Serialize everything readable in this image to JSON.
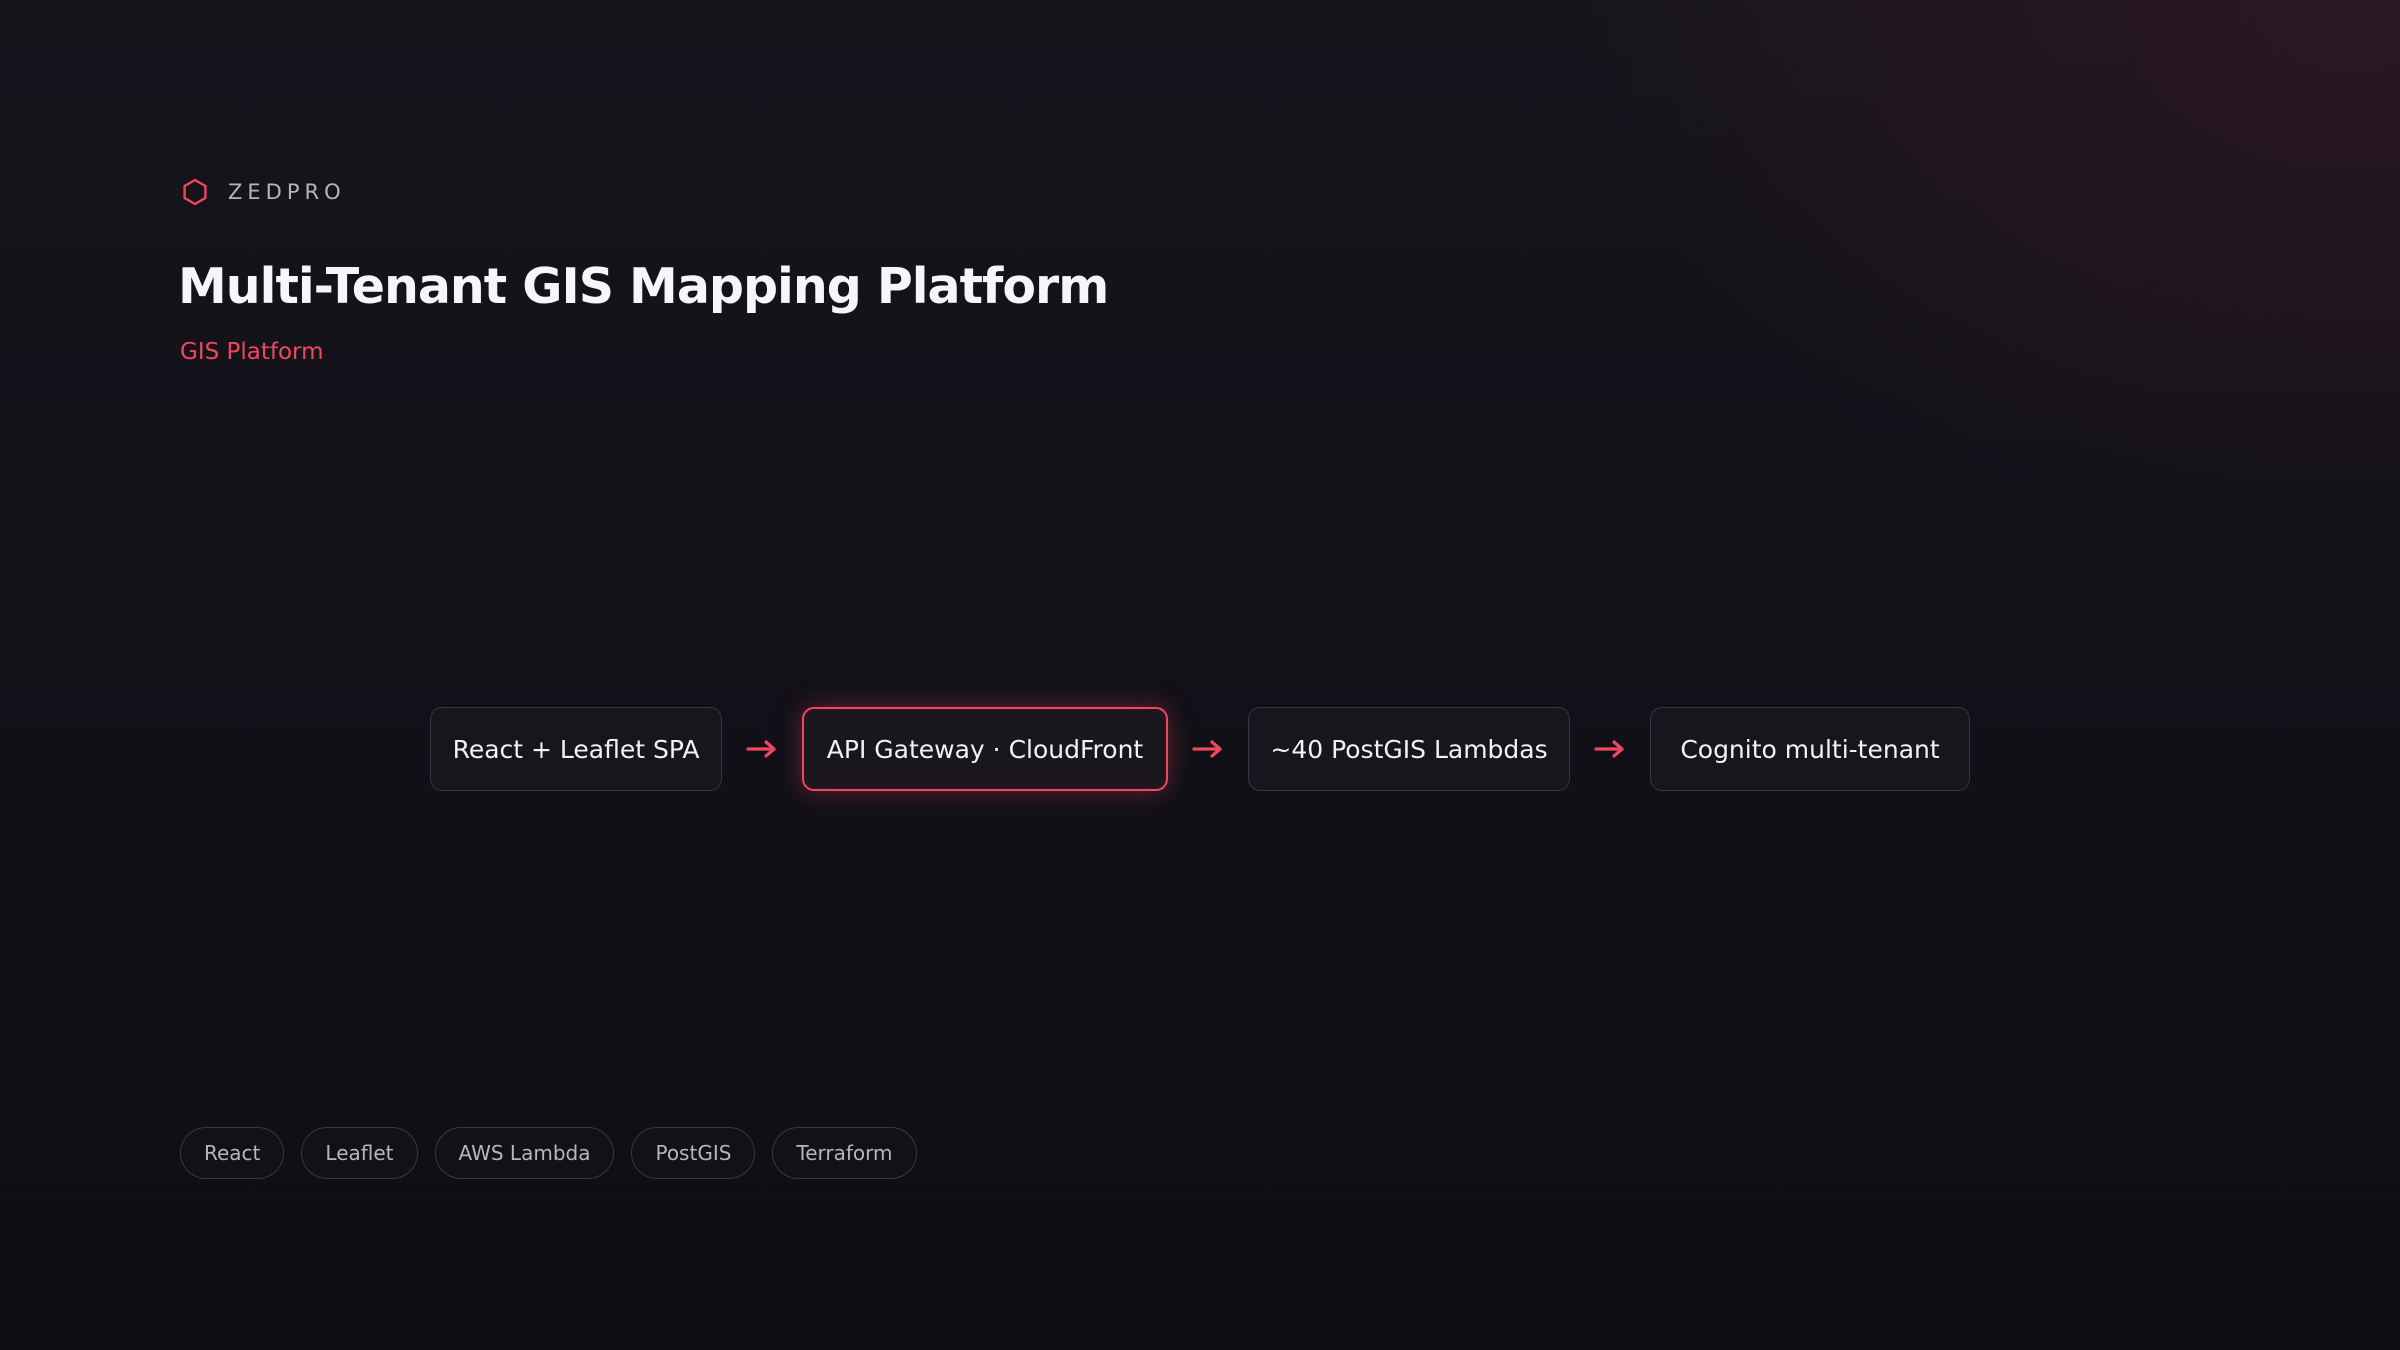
{
  "brand": {
    "name": "ZEDPRO",
    "icon": "hexagon-outline-icon",
    "accent_color": "#f0475f"
  },
  "header": {
    "title": "Multi-Tenant GIS Mapping Platform",
    "subtitle": "GIS Platform"
  },
  "flow": {
    "nodes": [
      {
        "label": "React + Leaflet SPA",
        "highlighted": false
      },
      {
        "label": "API Gateway · CloudFront",
        "highlighted": true
      },
      {
        "label": "~40 PostGIS Lambdas",
        "highlighted": false
      },
      {
        "label": "Cognito multi-tenant",
        "highlighted": false
      }
    ],
    "arrow_icon": "arrow-right-icon",
    "arrow_color": "#f0475f"
  },
  "tags": [
    "React",
    "Leaflet",
    "AWS Lambda",
    "PostGIS",
    "Terraform"
  ],
  "colors": {
    "background": "#121118",
    "node_border": "#38363e",
    "text_primary": "#f3f1f4",
    "text_muted": "#b7b3bc"
  }
}
